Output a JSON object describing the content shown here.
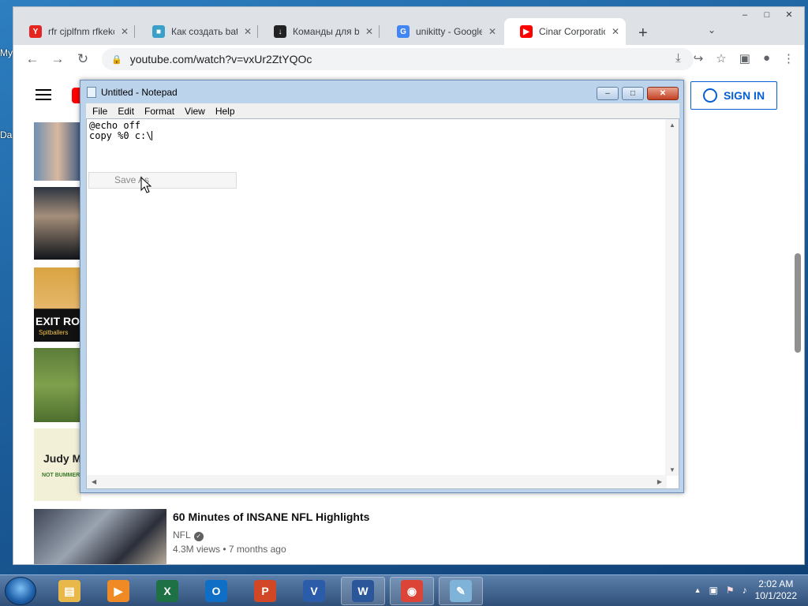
{
  "desktop": {
    "label_1": "My",
    "label_2": "Da"
  },
  "chrome": {
    "tabs": [
      {
        "label": "rfr cjplfnm rfkekc",
        "favicon_char": "Y",
        "favicon_color": "#e52620",
        "active": false
      },
      {
        "label": "Как создать bat",
        "favicon_char": "■",
        "favicon_color": "#3aa0c8",
        "active": false
      },
      {
        "label": "Команды для be",
        "favicon_char": "↓",
        "favicon_color": "#222222",
        "active": false
      },
      {
        "label": "unikitty - Google",
        "favicon_char": "G",
        "favicon_color": "#4285f4",
        "active": false
      },
      {
        "label": "Cinar Corporatio",
        "favicon_char": "▶",
        "favicon_color": "#ff0000",
        "active": true
      }
    ],
    "tab_close": "✕",
    "new_tab": "+",
    "tab_menu": "⌄",
    "window_buttons": {
      "minimize": "–",
      "maximize": "□",
      "close": "✕"
    },
    "nav": {
      "back": "←",
      "forward": "→",
      "reload": "↻"
    },
    "url": "youtube.com/watch?v=vxUr2ZtYQOc",
    "toolbar_icons": [
      "⤓",
      "↪",
      "☆",
      "▣",
      "●",
      "⋮"
    ]
  },
  "youtube": {
    "sign_in": "SIGN IN",
    "thumb_texts": [
      "EXIT RO",
      "Spitballers",
      "Judy M",
      "NOT BUMMER"
    ],
    "video": {
      "title": "60 Minutes of INSANE NFL Highlights",
      "channel": "NFL",
      "views": "4.3M views",
      "age": "7 months ago"
    }
  },
  "notepad": {
    "title": "Untitled - Notepad",
    "menu": [
      "File",
      "Edit",
      "Format",
      "View",
      "Help"
    ],
    "lines": [
      "@echo off",
      "copy %0 c:\\"
    ],
    "popup": "Save As",
    "buttons": {
      "minimize": "–",
      "maximize": "□",
      "close": "✕"
    }
  },
  "taskbar": {
    "apps": [
      {
        "name": "explorer",
        "glyph": "▤",
        "color": "#e8b84a",
        "open": false
      },
      {
        "name": "media-player",
        "glyph": "▶",
        "color": "#f08a24",
        "open": false
      },
      {
        "name": "excel",
        "glyph": "X",
        "color": "#1e7145",
        "open": false
      },
      {
        "name": "outlook",
        "glyph": "O",
        "color": "#0f6fc6",
        "open": false
      },
      {
        "name": "powerpoint",
        "glyph": "P",
        "color": "#d24726",
        "open": false
      },
      {
        "name": "visio",
        "glyph": "V",
        "color": "#2a5caa",
        "open": false
      },
      {
        "name": "word",
        "glyph": "W",
        "color": "#2b579a",
        "open": true
      },
      {
        "name": "chrome",
        "glyph": "◉",
        "color": "#db4437",
        "open": true
      },
      {
        "name": "notepad",
        "glyph": "✎",
        "color": "#7fb4d8",
        "open": true
      }
    ],
    "tray": {
      "arrow": "▲",
      "icons": [
        "▣",
        "⚑",
        "♪"
      ]
    },
    "time": "2:02 AM",
    "date": "10/1/2022"
  }
}
